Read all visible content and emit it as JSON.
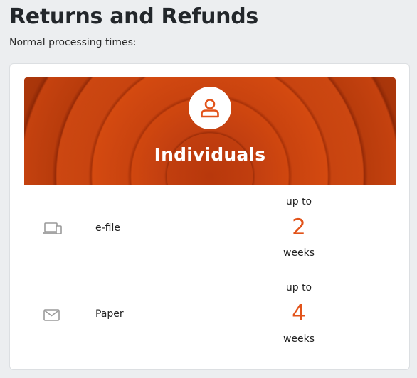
{
  "page": {
    "title": "Returns and Refunds",
    "subtitle": "Normal processing times:"
  },
  "card": {
    "banner_title": "Individuals",
    "banner_icon": "person-icon",
    "accent_color": "#e2531a",
    "rows": [
      {
        "icon": "devices-icon",
        "label": "e-file",
        "prefix": "up to",
        "value": "2",
        "unit": "weeks"
      },
      {
        "icon": "envelope-icon",
        "label": "Paper",
        "prefix": "up to",
        "value": "4",
        "unit": "weeks"
      }
    ]
  }
}
